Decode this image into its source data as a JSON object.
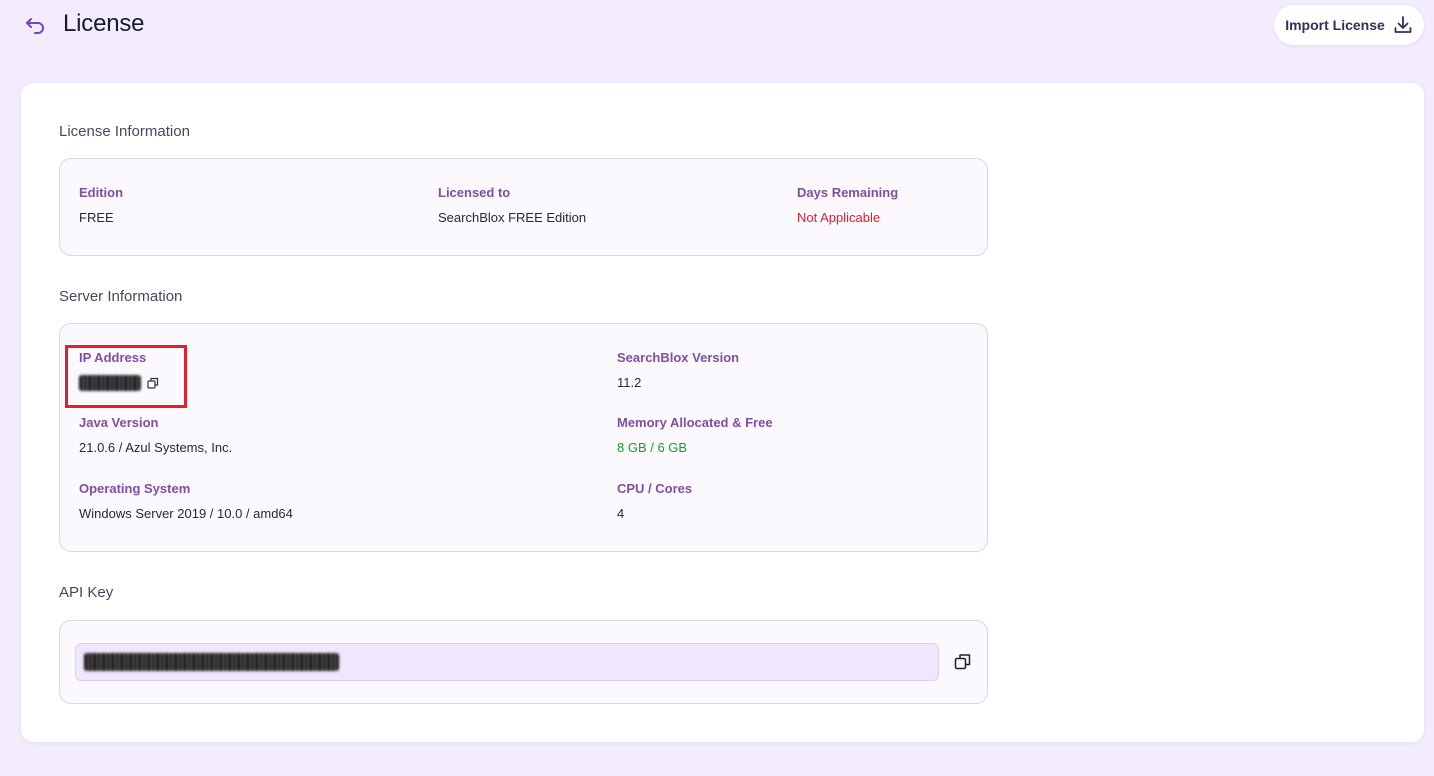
{
  "header": {
    "title": "License",
    "import_label": "Import License"
  },
  "license": {
    "section_title": "License Information",
    "edition_label": "Edition",
    "edition_value": "FREE",
    "licensed_to_label": "Licensed to",
    "licensed_to_value": "SearchBlox FREE Edition",
    "days_label": "Days Remaining",
    "days_value": "Not Applicable"
  },
  "server": {
    "section_title": "Server Information",
    "ip_label": "IP Address",
    "searchblox_version_label": "SearchBlox Version",
    "searchblox_version_value": "11.2",
    "java_label": "Java Version",
    "java_value": "21.0.6 / Azul Systems, Inc.",
    "memory_label": "Memory Allocated & Free",
    "memory_value": "8 GB / 6 GB",
    "os_label": "Operating System",
    "os_value": "Windows Server 2019 / 10.0 / amd64",
    "cpu_label": "CPU / Cores",
    "cpu_value": "4"
  },
  "api": {
    "section_title": "API Key"
  },
  "icons": {
    "back": "back-arrow-icon",
    "download": "download-icon",
    "copy": "copy-icon"
  },
  "colors": {
    "background": "#f3ecfd",
    "label_purple": "#7e4fa2",
    "error_red": "#e0202a",
    "success_green": "#1e9a2c",
    "highlight_box": "#e0202a"
  }
}
